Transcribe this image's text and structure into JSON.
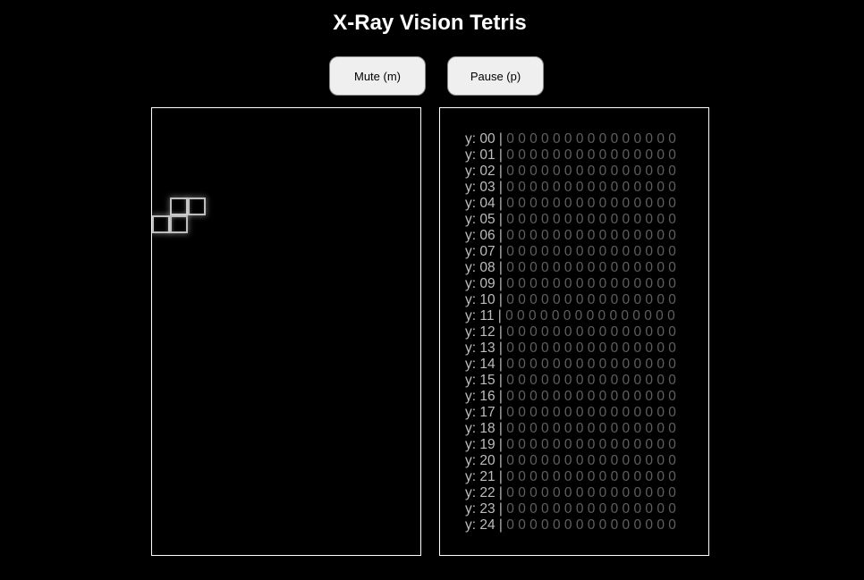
{
  "title": "X-Ray Vision Tetris",
  "buttons": {
    "mute_label": "Mute (m)",
    "pause_label": "Pause (p)"
  },
  "board": {
    "columns": 15,
    "visible_rows": 25,
    "active_piece": {
      "shape": "S",
      "cells": [
        [
          1,
          5
        ],
        [
          2,
          5
        ],
        [
          0,
          6
        ],
        [
          1,
          6
        ]
      ]
    }
  },
  "xray": {
    "rows": [
      {
        "label": "y: 00",
        "sep": "|",
        "cells": "0 0 0 0 0 0 0 0 0 0 0 0 0 0 0"
      },
      {
        "label": "y: 01",
        "sep": "|",
        "cells": "0 0 0 0 0 0 0 0 0 0 0 0 0 0 0"
      },
      {
        "label": "y: 02",
        "sep": "|",
        "cells": "0 0 0 0 0 0 0 0 0 0 0 0 0 0 0"
      },
      {
        "label": "y: 03",
        "sep": "|",
        "cells": "0 0 0 0 0 0 0 0 0 0 0 0 0 0 0"
      },
      {
        "label": "y: 04",
        "sep": "|",
        "cells": "0 0 0 0 0 0 0 0 0 0 0 0 0 0 0"
      },
      {
        "label": "y: 05",
        "sep": "|",
        "cells": "0 0 0 0 0 0 0 0 0 0 0 0 0 0 0"
      },
      {
        "label": "y: 06",
        "sep": "|",
        "cells": "0 0 0 0 0 0 0 0 0 0 0 0 0 0 0"
      },
      {
        "label": "y: 07",
        "sep": "|",
        "cells": "0 0 0 0 0 0 0 0 0 0 0 0 0 0 0"
      },
      {
        "label": "y: 08",
        "sep": "|",
        "cells": "0 0 0 0 0 0 0 0 0 0 0 0 0 0 0"
      },
      {
        "label": "y: 09",
        "sep": "|",
        "cells": "0 0 0 0 0 0 0 0 0 0 0 0 0 0 0"
      },
      {
        "label": "y: 10",
        "sep": "|",
        "cells": "0 0 0 0 0 0 0 0 0 0 0 0 0 0 0"
      },
      {
        "label": "y: 11",
        "sep": "|",
        "cells": "0 0 0 0 0 0 0 0 0 0 0 0 0 0 0"
      },
      {
        "label": "y: 12",
        "sep": "|",
        "cells": "0 0 0 0 0 0 0 0 0 0 0 0 0 0 0"
      },
      {
        "label": "y: 13",
        "sep": "|",
        "cells": "0 0 0 0 0 0 0 0 0 0 0 0 0 0 0"
      },
      {
        "label": "y: 14",
        "sep": "|",
        "cells": "0 0 0 0 0 0 0 0 0 0 0 0 0 0 0"
      },
      {
        "label": "y: 15",
        "sep": "|",
        "cells": "0 0 0 0 0 0 0 0 0 0 0 0 0 0 0"
      },
      {
        "label": "y: 16",
        "sep": "|",
        "cells": "0 0 0 0 0 0 0 0 0 0 0 0 0 0 0"
      },
      {
        "label": "y: 17",
        "sep": "|",
        "cells": "0 0 0 0 0 0 0 0 0 0 0 0 0 0 0"
      },
      {
        "label": "y: 18",
        "sep": "|",
        "cells": "0 0 0 0 0 0 0 0 0 0 0 0 0 0 0"
      },
      {
        "label": "y: 19",
        "sep": "|",
        "cells": "0 0 0 0 0 0 0 0 0 0 0 0 0 0 0"
      },
      {
        "label": "y: 20",
        "sep": "|",
        "cells": "0 0 0 0 0 0 0 0 0 0 0 0 0 0 0"
      },
      {
        "label": "y: 21",
        "sep": "|",
        "cells": "0 0 0 0 0 0 0 0 0 0 0 0 0 0 0"
      },
      {
        "label": "y: 22",
        "sep": "|",
        "cells": "0 0 0 0 0 0 0 0 0 0 0 0 0 0 0"
      },
      {
        "label": "y: 23",
        "sep": "|",
        "cells": "0 0 0 0 0 0 0 0 0 0 0 0 0 0 0"
      },
      {
        "label": "y: 24",
        "sep": "|",
        "cells": "0 0 0 0 0 0 0 0 0 0 0 0 0 0 0"
      }
    ]
  },
  "colors": {
    "background": "#000000",
    "border": "#ffffff",
    "piece_outline": "#bdbdbd",
    "grid_zero": "#5f5f5f",
    "row_label": "#bdbdbd"
  }
}
